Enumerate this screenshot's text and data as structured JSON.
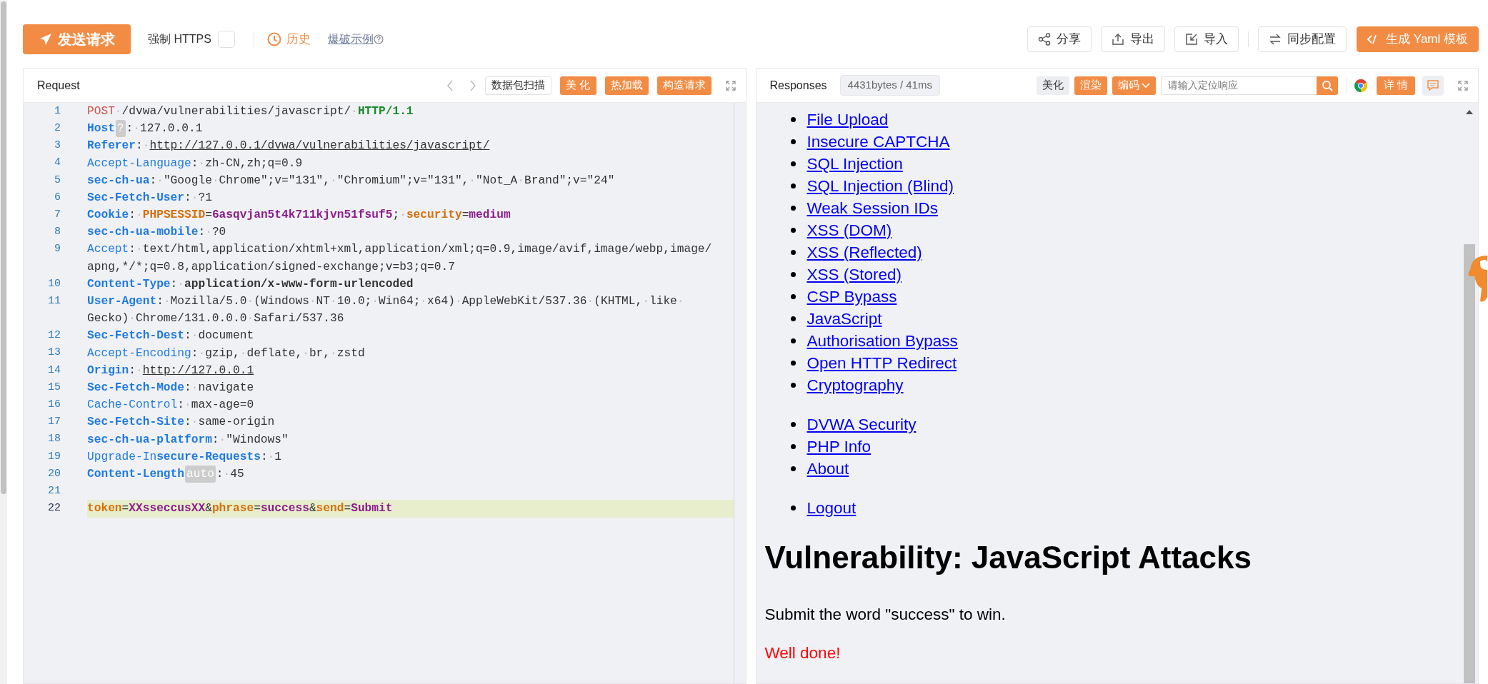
{
  "toolbar": {
    "send_button": "发送请求",
    "force_https": {
      "label": "强制 HTTPS",
      "checked": false
    },
    "history_link": "历史",
    "example_link": "爆破示例",
    "actions": [
      {
        "label": "分享",
        "kind": "outline"
      },
      {
        "label": "导出",
        "kind": "outline"
      },
      {
        "label": "导入",
        "kind": "outline"
      },
      {
        "label": "同步配置",
        "kind": "outline"
      },
      {
        "label": "生成 Yaml 模板",
        "kind": "primary"
      }
    ]
  },
  "request": {
    "title": "Request",
    "buttons": [
      {
        "label": "数据包扫描",
        "kind": "outline"
      },
      {
        "label": "美 化",
        "kind": "primary"
      },
      {
        "label": "热加载",
        "kind": "primary"
      },
      {
        "label": "构造请求",
        "kind": "primary"
      }
    ],
    "lines": [
      {
        "number": "1",
        "selected": false,
        "segments": [
          {
            "kind": "method",
            "text": "POST"
          },
          {
            "kind": "plain",
            "text": "·/dvwa/vulnerabilities/javascript/·"
          },
          {
            "kind": "version",
            "text": "HTTP/1.1"
          }
        ]
      },
      {
        "number": "2",
        "selected": false,
        "segments": [
          {
            "kind": "key_bold",
            "text": "Host"
          },
          {
            "kind": "badge",
            "text": "?"
          },
          {
            "kind": "plain",
            "text": ":·127.0.0.1"
          }
        ]
      },
      {
        "number": "3",
        "selected": false,
        "segments": [
          {
            "kind": "key_bold",
            "text": "Referer"
          },
          {
            "kind": "plain",
            "text": ":·"
          },
          {
            "kind": "url",
            "text": "http://127.0.0.1/dvwa/vulnerabilities/javascript/"
          }
        ]
      },
      {
        "number": "4",
        "selected": false,
        "segments": [
          {
            "kind": "key",
            "text": "Accept-Language"
          },
          {
            "kind": "plain",
            "text": ":·zh-CN,zh;q=0.9"
          }
        ]
      },
      {
        "number": "5",
        "selected": false,
        "segments": [
          {
            "kind": "key_bold",
            "text": "sec-ch-ua"
          },
          {
            "kind": "plain",
            "text": ":·\"Google·Chrome\";v=\"131\",·\"Chromium\";v=\"131\",·\"Not_A·Brand\";v=\"24\""
          }
        ]
      },
      {
        "number": "6",
        "selected": false,
        "segments": [
          {
            "kind": "key_bold",
            "text": "Sec-Fetch-User"
          },
          {
            "kind": "plain",
            "text": ":·?1"
          }
        ]
      },
      {
        "number": "7",
        "selected": false,
        "segments": [
          {
            "kind": "key_bold",
            "text": "Cookie"
          },
          {
            "kind": "plain",
            "text": ":·"
          },
          {
            "kind": "param_name",
            "text": "PHPSESSID"
          },
          {
            "kind": "plain",
            "text": "="
          },
          {
            "kind": "param_value",
            "text": "6asqvjan5t4k711kjvn51fsuf5"
          },
          {
            "kind": "plain",
            "text": ";·"
          },
          {
            "kind": "param_name",
            "text": "security"
          },
          {
            "kind": "plain",
            "text": "="
          },
          {
            "kind": "param_value",
            "text": "medium"
          }
        ]
      },
      {
        "number": "8",
        "selected": false,
        "segments": [
          {
            "kind": "key_bold",
            "text": "sec-ch-ua-mobile"
          },
          {
            "kind": "plain",
            "text": ":·?0"
          }
        ]
      },
      {
        "number": "9",
        "selected": false,
        "segments": [
          {
            "kind": "key",
            "text": "Accept"
          },
          {
            "kind": "plain",
            "text": ":·text/html,application/xhtml+xml,application/xml;q=0.9,image/avif,image/webp,image/"
          }
        ],
        "continuation": "apng,*/*;q=0.8,application/signed-exchange;v=b3;q=0.7"
      },
      {
        "number": "10",
        "selected": false,
        "segments": [
          {
            "kind": "key_bold",
            "text": "Content-Type"
          },
          {
            "kind": "plain",
            "text": ":·"
          },
          {
            "kind": "strong",
            "text": "application/x-www-form-urlencoded"
          }
        ]
      },
      {
        "number": "11",
        "selected": false,
        "segments": [
          {
            "kind": "key_bold",
            "text": "User-Agent"
          },
          {
            "kind": "plain",
            "text": ":·Mozilla/5.0·(Windows·NT·10.0;·Win64;·x64)·AppleWebKit/537.36·(KHTML,·like·"
          }
        ],
        "continuation": "Gecko)·Chrome/131.0.0.0·Safari/537.36"
      },
      {
        "number": "12",
        "selected": false,
        "segments": [
          {
            "kind": "key_bold",
            "text": "Sec-Fetch-Dest"
          },
          {
            "kind": "plain",
            "text": ":·document"
          }
        ]
      },
      {
        "number": "13",
        "selected": false,
        "segments": [
          {
            "kind": "key",
            "text": "Accept-Encoding"
          },
          {
            "kind": "plain",
            "text": ":·gzip,·deflate,·br,·zstd"
          }
        ]
      },
      {
        "number": "14",
        "selected": false,
        "segments": [
          {
            "kind": "key_bold",
            "text": "Origin"
          },
          {
            "kind": "plain",
            "text": ":·"
          },
          {
            "kind": "url",
            "text": "http://127.0.0.1"
          }
        ]
      },
      {
        "number": "15",
        "selected": false,
        "segments": [
          {
            "kind": "key_bold",
            "text": "Sec-Fetch-Mode"
          },
          {
            "kind": "plain",
            "text": ":·navigate"
          }
        ]
      },
      {
        "number": "16",
        "selected": false,
        "segments": [
          {
            "kind": "key",
            "text": "Cache-Control"
          },
          {
            "kind": "plain",
            "text": ":·max-age=0"
          }
        ]
      },
      {
        "number": "17",
        "selected": false,
        "segments": [
          {
            "kind": "key_bold",
            "text": "Sec-Fetch-Site"
          },
          {
            "kind": "plain",
            "text": ":·same-origin"
          }
        ]
      },
      {
        "number": "18",
        "selected": false,
        "segments": [
          {
            "kind": "key_bold",
            "text": "sec-ch-ua-platform"
          },
          {
            "kind": "plain",
            "text": ":·\"Windows\""
          }
        ]
      },
      {
        "number": "19",
        "selected": false,
        "segments": [
          {
            "kind": "key",
            "text": "Upgrade-In"
          },
          {
            "kind": "key_bold",
            "text": "secure-Requests"
          },
          {
            "kind": "plain",
            "text": ":·1"
          }
        ]
      },
      {
        "number": "20",
        "selected": false,
        "segments": [
          {
            "kind": "key_bold",
            "text": "Content-Length"
          },
          {
            "kind": "badge",
            "text": "auto"
          },
          {
            "kind": "plain",
            "text": ":·45"
          }
        ]
      },
      {
        "number": "21",
        "selected": false
      },
      {
        "number": "22",
        "selected": true,
        "segments": [
          {
            "kind": "param_name",
            "text": "token"
          },
          {
            "kind": "plain",
            "text": "="
          },
          {
            "kind": "param_value",
            "text": "XXsseccusXX"
          },
          {
            "kind": "plain",
            "text": "&"
          },
          {
            "kind": "param_name",
            "text": "phrase"
          },
          {
            "kind": "plain",
            "text": "="
          },
          {
            "kind": "param_value",
            "text": "success"
          },
          {
            "kind": "plain",
            "text": "&"
          },
          {
            "kind": "param_name",
            "text": "send"
          },
          {
            "kind": "plain",
            "text": "="
          },
          {
            "kind": "param_value",
            "text": "Submit"
          }
        ]
      }
    ]
  },
  "response": {
    "title": "Responses",
    "stats": "4431bytes / 41ms",
    "buttons": [
      {
        "label": "美化",
        "kind": "plain"
      },
      {
        "label": "渲染",
        "kind": "primary"
      },
      {
        "label": "编码",
        "kind": "dropdown"
      }
    ],
    "search": {
      "placeholder": "请输入定位响应"
    },
    "detail_button": "详 情",
    "page": {
      "link_groups": [
        [
          "File Upload",
          "Insecure CAPTCHA",
          "SQL Injection",
          "SQL Injection (Blind)",
          "Weak Session IDs",
          "XSS (DOM)",
          "XSS (Reflected)",
          "XSS (Stored)",
          "CSP Bypass",
          "JavaScript",
          "Authorisation Bypass",
          "Open HTTP Redirect",
          "Cryptography"
        ],
        [
          "DVWA Security",
          "PHP Info",
          "About"
        ],
        [
          "Logout"
        ]
      ],
      "heading": "Vulnerability: JavaScript Attacks",
      "instruction": "Submit the word \"success\" to win.",
      "message": "Well done!"
    }
  }
}
